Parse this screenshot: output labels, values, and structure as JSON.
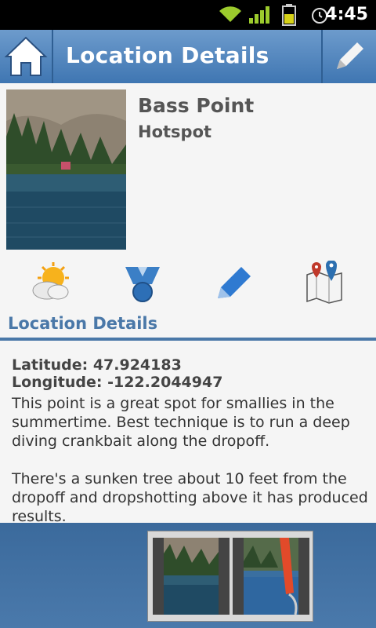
{
  "status": {
    "time": "4:45",
    "icons": [
      "wifi-icon",
      "signal-icon",
      "battery-icon",
      "alarm-icon"
    ]
  },
  "appbar": {
    "title": "Location Details",
    "home_icon": "home-icon",
    "edit_icon": "pencil-icon"
  },
  "location": {
    "name": "Bass Point",
    "type": "Hotspot"
  },
  "actions": [
    {
      "icon": "weather-icon"
    },
    {
      "icon": "badge-icon"
    },
    {
      "icon": "edit-pencil-icon"
    },
    {
      "icon": "map-icon"
    }
  ],
  "section": {
    "title": "Location Details"
  },
  "details": {
    "latitude": "Latitude: 47.924183",
    "longitude": "Longitude: -122.2044947",
    "description": "This point is a great spot for smallies in the summertime. Best technique is to run a deep diving crankbait along the dropoff.\n\nThere's a sunken tree about 10 feet from the dropoff and dropshotting above it has produced results."
  },
  "colors": {
    "accent": "#4a78a8",
    "appbar": "#5185be",
    "background": "#f5f5f5"
  }
}
